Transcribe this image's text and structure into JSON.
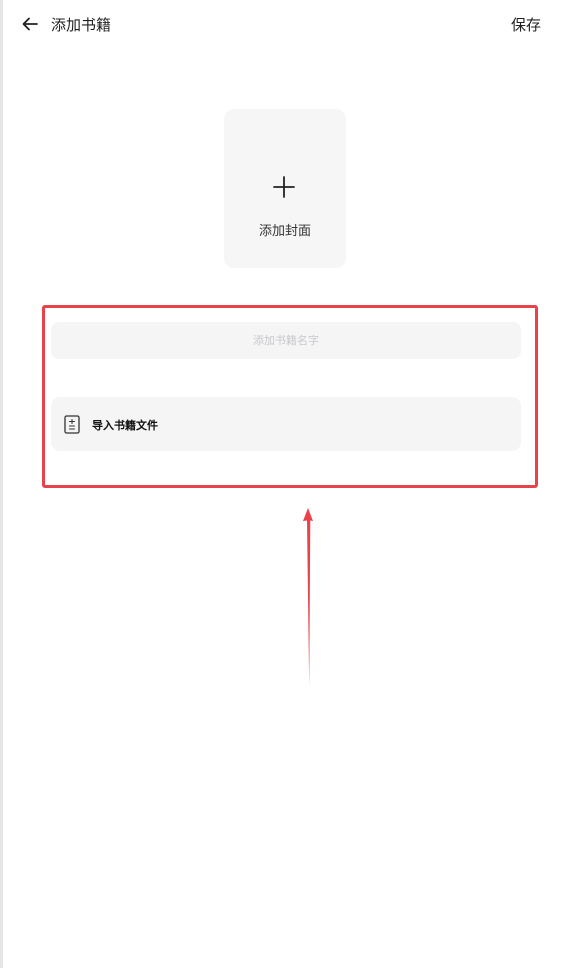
{
  "header": {
    "back_icon": "arrow-left-icon",
    "title": "添加书籍",
    "save_label": "保存"
  },
  "cover": {
    "icon": "plus-icon",
    "label": "添加封面"
  },
  "form": {
    "name_placeholder": "添加书籍名字",
    "name_value": "",
    "import_icon": "document-icon",
    "import_label": "导入书籍文件"
  },
  "annotation": {
    "highlight_color": "#e8424a",
    "arrow_color": "#e8424a"
  }
}
